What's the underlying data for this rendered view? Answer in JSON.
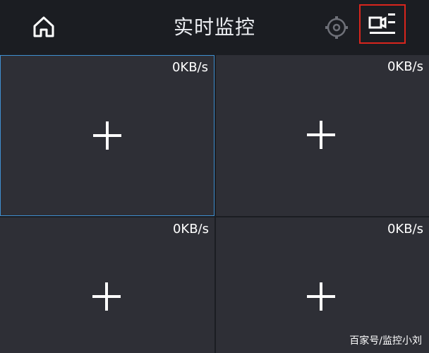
{
  "header": {
    "title": "实时监控",
    "icons": {
      "home": "home-icon",
      "settings": "gear-icon",
      "camera_list": "camera-list-icon"
    }
  },
  "tiles": [
    {
      "rate": "0KB/s",
      "selected": true,
      "icon": "plus-icon"
    },
    {
      "rate": "0KB/s",
      "selected": false,
      "icon": "plus-icon"
    },
    {
      "rate": "0KB/s",
      "selected": false,
      "icon": "plus-icon"
    },
    {
      "rate": "0KB/s",
      "selected": false,
      "icon": "plus-icon"
    }
  ],
  "watermark": "百家号/监控小刘",
  "colors": {
    "background": "#1b1d22",
    "tile": "#2e2f36",
    "selected_border": "#3f8fd0",
    "highlight_box": "#d9251d",
    "text": "#ffffff"
  }
}
